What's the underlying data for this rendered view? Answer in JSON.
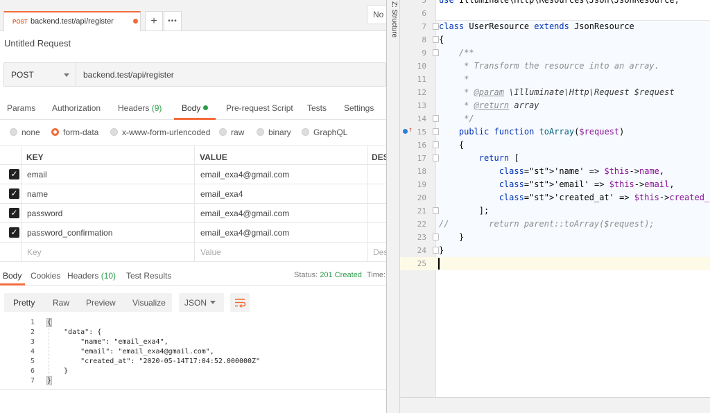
{
  "postman": {
    "request_tab": {
      "method": "POST",
      "url": "backend.test/api/register"
    },
    "new_tab_symbol": "+",
    "more_symbol": "•••",
    "environment_label": "No",
    "request_title": "Untitled Request",
    "method": "POST",
    "url": "backend.test/api/register",
    "request_tabs": {
      "params": "Params",
      "authorization": "Authorization",
      "headers": "Headers",
      "headers_count": "(9)",
      "body": "Body",
      "prerequest": "Pre-request Script",
      "tests": "Tests",
      "settings": "Settings"
    },
    "body_types": [
      "none",
      "form-data",
      "x-www-form-urlencoded",
      "raw",
      "binary",
      "GraphQL"
    ],
    "selected_body_type": "form-data",
    "table": {
      "headers": {
        "key": "KEY",
        "value": "VALUE",
        "description": "DESC"
      },
      "rows": [
        {
          "key": "email",
          "value": "email_exa4@gmail.com",
          "checked": true
        },
        {
          "key": "name",
          "value": "email_exa4",
          "checked": true
        },
        {
          "key": "password",
          "value": "email_exa4@gmail.com",
          "checked": true
        },
        {
          "key": "password_confirmation",
          "value": "email_exa4@gmail.com",
          "checked": true
        }
      ],
      "placeholder": {
        "key": "Key",
        "value": "Value",
        "description": "Des"
      }
    },
    "response_tabs": {
      "body": "Body",
      "cookies": "Cookies",
      "headers": "Headers",
      "headers_count": "(10)",
      "test_results": "Test Results"
    },
    "status_label": "Status:",
    "status_value": "201 Created",
    "time_label": "Time:",
    "format_buttons": [
      "Pretty",
      "Raw",
      "Preview",
      "Visualize"
    ],
    "format_select": "JSON",
    "response_lines": [
      {
        "n": "1",
        "text": "{"
      },
      {
        "n": "2",
        "text": "    \"data\": {"
      },
      {
        "n": "3",
        "text": "        \"name\": \"email_exa4\","
      },
      {
        "n": "4",
        "text": "        \"email\": \"email_exa4@gmail.com\","
      },
      {
        "n": "5",
        "text": "        \"created_at\": \"2020-05-14T17:04:52.000000Z\""
      },
      {
        "n": "6",
        "text": "    }"
      },
      {
        "n": "7",
        "text": "}"
      }
    ]
  },
  "ide": {
    "structure_label": "Z: Structure",
    "line_numbers": [
      "5",
      "6",
      "7",
      "8",
      "9",
      "10",
      "11",
      "12",
      "13",
      "14",
      "15",
      "16",
      "17",
      "18",
      "19",
      "20",
      "21",
      "22",
      "23",
      "24",
      "25"
    ],
    "lines": [
      "use Illuminate\\Http\\Resources\\Json\\JsonResource;",
      "",
      "class UserResource extends JsonResource",
      "{",
      "    /**",
      "     * Transform the resource into an array.",
      "     *",
      "     * @param \\Illuminate\\Http\\Request $request",
      "     * @return array",
      "     */",
      "    public function toArray($request)",
      "    {",
      "        return [",
      "            'name' => $this->name,",
      "            'email' => $this->email,",
      "            'created_at' => $this->created_at,",
      "        ];",
      "//        return parent::toArray($request);",
      "    }",
      "}",
      ""
    ]
  },
  "colors": {
    "accent": "#f26b3a",
    "status_green": "#2c9d4a",
    "keyword_blue": "#0033b3",
    "string_green": "#067d17",
    "variable_purple": "#871094"
  }
}
